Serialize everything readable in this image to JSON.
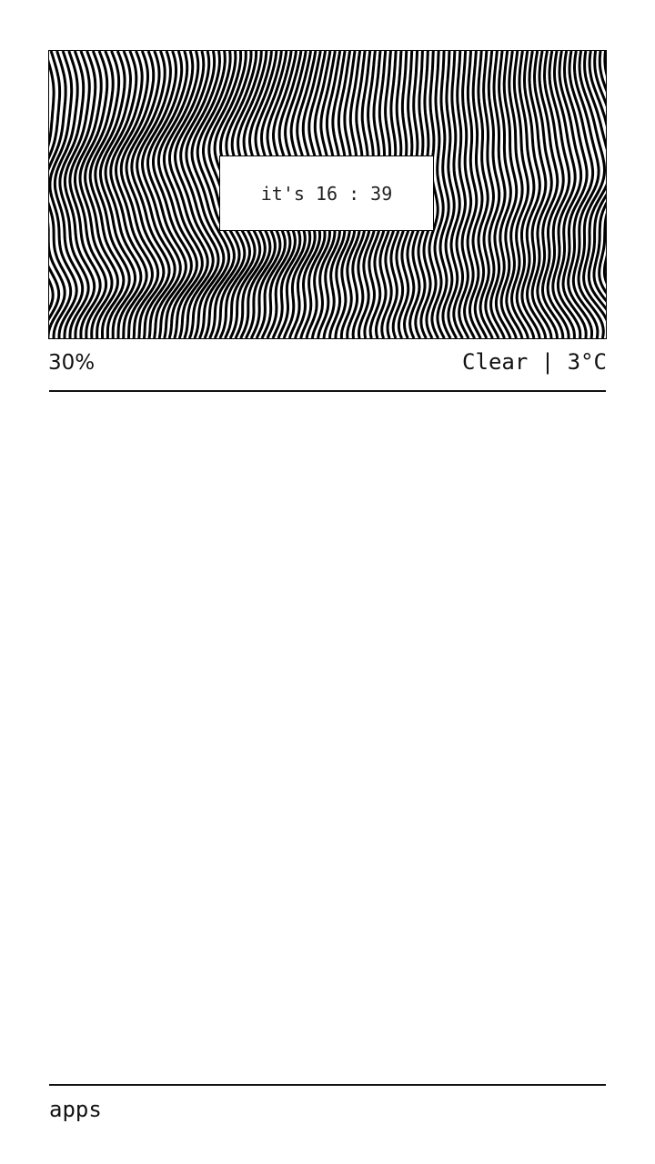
{
  "widget": {
    "clock_text": "it's 16 : 39"
  },
  "status": {
    "battery": "30%",
    "weather": "Clear | 3°C"
  },
  "footer": {
    "apps_label": "apps"
  },
  "colors": {
    "background": "#ffffff",
    "foreground": "#111111"
  }
}
